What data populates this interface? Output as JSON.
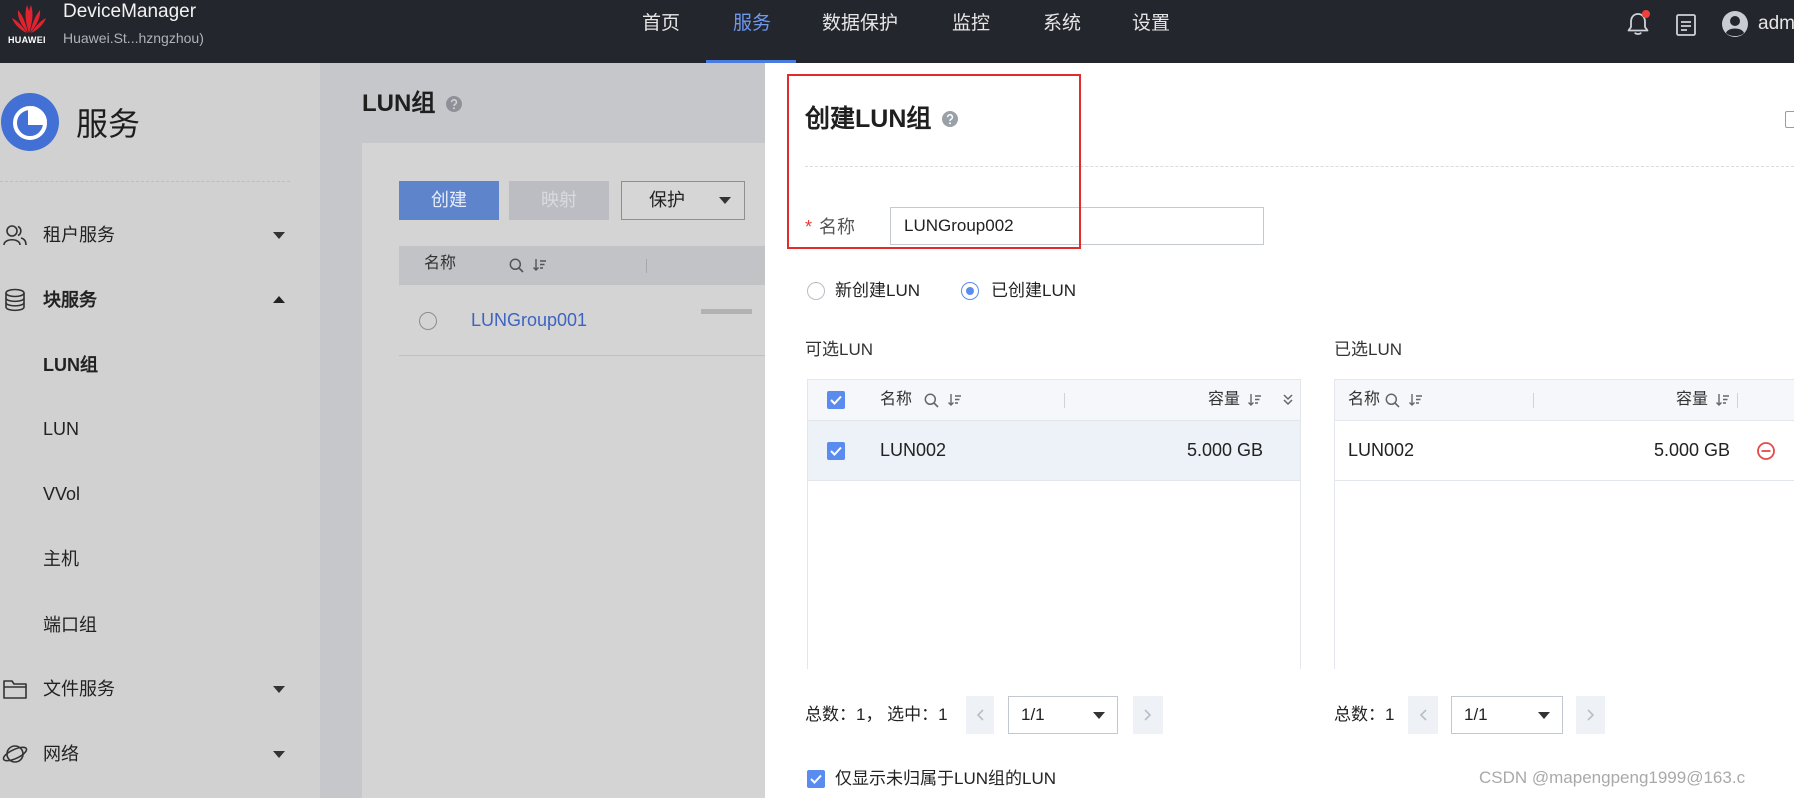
{
  "app": {
    "logo_text": "HUAWEI",
    "title": "DeviceManager",
    "subtitle": "Huawei.St...hzngzhou)"
  },
  "nav": {
    "items": [
      {
        "label": "首页",
        "active": false
      },
      {
        "label": "服务",
        "active": true
      },
      {
        "label": "数据保护",
        "active": false
      },
      {
        "label": "监控",
        "active": false
      },
      {
        "label": "系统",
        "active": false
      },
      {
        "label": "设置",
        "active": false
      }
    ]
  },
  "header_right": {
    "icons": [
      "bell-icon",
      "task-list-icon",
      "user-avatar-icon"
    ],
    "notification_dot": true,
    "user_name": "admi"
  },
  "sidebar": {
    "title": "服务",
    "icon": "service-pie-icon",
    "items": [
      {
        "label": "租户服务",
        "icon": "tenant-users-icon",
        "expanded": false
      },
      {
        "label": "块服务",
        "icon": "database-icon",
        "expanded": true
      },
      {
        "label": "LUN组",
        "active": true
      },
      {
        "label": "LUN",
        "active": false
      },
      {
        "label": "VVol",
        "active": false
      },
      {
        "label": "主机",
        "active": false
      },
      {
        "label": "端口组",
        "active": false
      },
      {
        "label": "文件服务",
        "icon": "folder-icon",
        "expanded": false
      },
      {
        "label": "网络",
        "icon": "network-icon",
        "expanded": false
      }
    ]
  },
  "main": {
    "title": "LUN组",
    "toolbar": {
      "create_label": "创建",
      "map_label": "映射",
      "map_disabled": true,
      "protect_label": "保护"
    },
    "table": {
      "column_name": "名称",
      "rows": [
        {
          "name": "LUNGroup001",
          "selected": false
        }
      ]
    }
  },
  "modal": {
    "title": "创建LUN组",
    "name_field": {
      "required_mark": "*",
      "label": "名称",
      "value": "LUNGroup002"
    },
    "lun_source": {
      "options": [
        "新创建LUN",
        "已创建LUN"
      ],
      "new_selected": false,
      "existing_selected": true
    },
    "available": {
      "title": "可选LUN",
      "column_name": "名称",
      "column_capacity": "容量",
      "header_checked": true,
      "rows": [
        {
          "name": "LUN002",
          "capacity": "5.000 GB",
          "checked": true
        }
      ],
      "footer_text": "总数：1， 选中：1",
      "page": "1/1"
    },
    "chosen": {
      "title": "已选LUN",
      "column_name": "名称",
      "column_capacity": "容量",
      "rows": [
        {
          "name": "LUN002",
          "capacity": "5.000 GB"
        }
      ],
      "footer_text": "总数：1",
      "page": "1/1"
    },
    "filter_checkbox": {
      "label": "仅显示未归属于LUN组的LUN",
      "checked": true
    }
  },
  "watermark": "CSDN @mapengpeng1999@163.c",
  "colors": {
    "topbar_bg": "#23262c",
    "nav_active": "#6f98ef",
    "accent": "#5a8cf0",
    "brand_red": "#e0232e",
    "annotation_red": "#e32b2b",
    "remove_red": "#e84848",
    "link": "#3d64c2"
  }
}
